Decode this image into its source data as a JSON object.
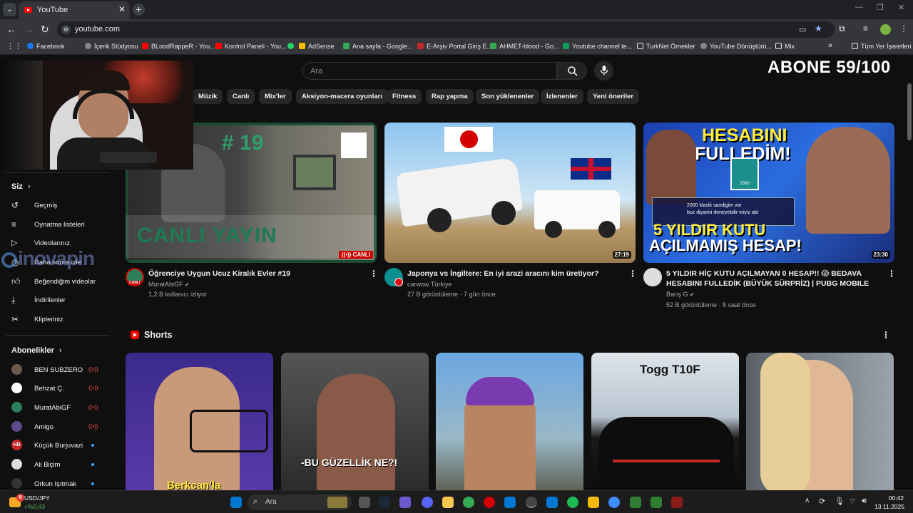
{
  "browser": {
    "tab_title": "YouTube",
    "url": "youtube.com",
    "bookmarks": [
      "Facebook",
      "İçerik Stüdyosu",
      "BLoodRappeR - You...",
      "Kontrol Paneli - You...",
      "AdSense",
      "Ana sayfa - Google...",
      "E-Arşiv Portal Giriş E...",
      "AHMET-blood - Go...",
      "Youtube channel te...",
      "TurkNet Örnekler",
      "YouTube Dönüştürü...",
      "Mix",
      "Tüm Yer İşaretleri"
    ]
  },
  "youtube": {
    "search_placeholder": "Ara",
    "overlay_text": "ABONE 59/100",
    "chips": [
      "Müzik",
      "Canlı",
      "Mix'ler",
      "Aksiyon-macera oyunları",
      "Fitness",
      "Rap yapma",
      "Son yüklenenler",
      "İzlenenler",
      "Yeni öneriler"
    ],
    "sidebar": {
      "you_label": "Siz",
      "items": [
        "Geçmiş",
        "Oynatma listeleri",
        "Videolarınız",
        "Daha sonra izle",
        "Beğendiğim videolar",
        "İndirilenler",
        "Klipleriniz"
      ],
      "subs_label": "Abonelikler",
      "subs": [
        "BEN SUBZERO",
        "Behzat Ç.",
        "MuratAbiGF",
        "Amigo",
        "Küçük Burjuvazi",
        "Ali Biçim",
        "Orkun Işıtmak"
      ]
    },
    "videos": [
      {
        "title": "Öğrenciye Uygun Ucuz Kiralık Evler #19",
        "channel": "MuratAbiGF",
        "meta": "1,2 B kullanıcı izliyor",
        "badge": "CANLI",
        "thumb_text_top": "# 19",
        "thumb_text_bottom": "CANLI YAYIN",
        "avatar_badge": "CANLI"
      },
      {
        "title": "Japonya vs İngiltere: En iyi arazi aracını kim üretiyor?",
        "channel": "carwow Türkiye",
        "meta": "27 B görüntüleme · 7 gün önce",
        "duration": "27:19"
      },
      {
        "title": "5 YILDIR HİÇ KUTU AÇILMAYAN 0 HESAP!! 😱 BEDAVA HESABINI FULLEDİK (BÜYÜK SÜRPRİZ) | PUBG MOBILE",
        "title_line1": "5 YILDIR HİÇ KUTU AÇILMAYAN 0 HESAP!! 😱 BEDAVA",
        "title_line2": "HESABINI FULLEDİK (BÜYÜK SÜRPRİZ) | PUBG MOBILE",
        "channel": "Barış G",
        "meta": "52 B görüntüleme · 8 saat önce",
        "duration": "23:30",
        "thumb_line1": "HESABINI",
        "thumb_line2": "FULLEDİM!",
        "thumb_line3": "5 YILDIR KUTU",
        "thumb_line4": "AÇILMAMIŞ HESAP!",
        "thumb_small1": "2000 klasik sandigim var",
        "thumb_small2": "buz diyarini deneyebilir miyiz abi",
        "thumb_small3": "2000"
      }
    ],
    "shorts_label": "Shorts",
    "shorts_captions": [
      "Berkcan'la",
      "-BU GÜZELLİK NE?!",
      "",
      "Togg T10F",
      ""
    ]
  },
  "watermark": "inovapin",
  "taskbar": {
    "ticker_label": "USD/JPY",
    "ticker_value": "+%0,43",
    "ticker_badge": "8",
    "search_placeholder": "Ara",
    "time": "00:42",
    "date": "13.11.2025"
  }
}
